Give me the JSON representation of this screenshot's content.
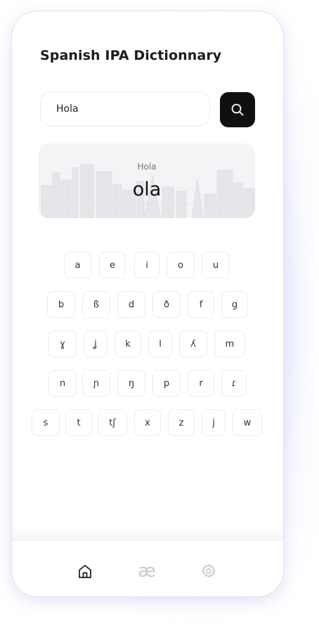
{
  "app": {
    "title": "Spanish IPA Dictionnary"
  },
  "search": {
    "value": "Hola",
    "button_icon": "search-icon"
  },
  "result": {
    "word": "Hola",
    "ipa": "ola"
  },
  "keyboard": {
    "rows": [
      [
        "a",
        "e",
        "i",
        "o",
        "u"
      ],
      [
        "b",
        "ß",
        "d",
        "ð",
        "f",
        "g"
      ],
      [
        "ɣ",
        "ʝ",
        "k",
        "l",
        "ʎ",
        "m"
      ],
      [
        "n",
        "ɲ",
        "ŋ",
        "p",
        "r",
        "ɾ"
      ],
      [
        "s",
        "t",
        "tʃ",
        "x",
        "z",
        "j",
        "w"
      ]
    ]
  },
  "nav": {
    "items": [
      {
        "name": "home",
        "icon": "home-icon",
        "active": true
      },
      {
        "name": "ipa",
        "icon": "ae-icon",
        "label": "æ",
        "active": false
      },
      {
        "name": "settings",
        "icon": "gear-icon",
        "active": false
      }
    ]
  },
  "colors": {
    "accent": "#101013",
    "inactive_icon": "#c9c9cf",
    "card_background": "#f4f4f6"
  }
}
